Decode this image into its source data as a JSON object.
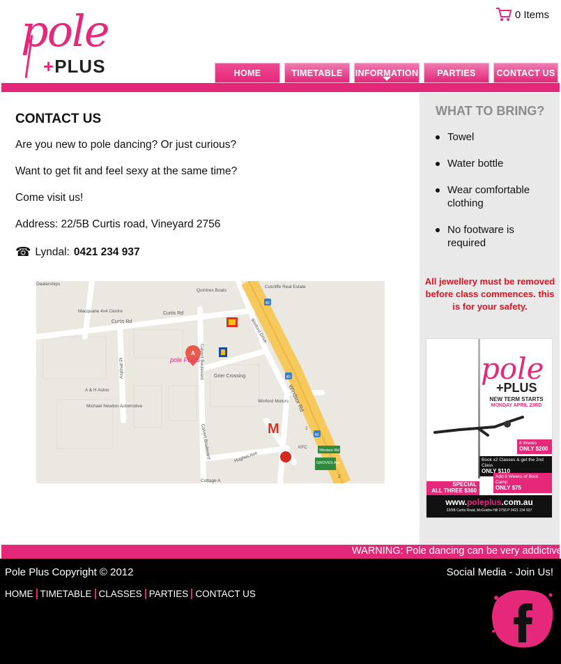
{
  "brand": {
    "logo_top": "pole",
    "logo_bottom": "PLUS",
    "accent": "#e3287a"
  },
  "cart": {
    "icon": "cart-icon",
    "label": "0 Items"
  },
  "nav": [
    {
      "label": "HOME",
      "active": true
    },
    {
      "label": "TIMETABLE",
      "active": false
    },
    {
      "label": "INFORMATION",
      "active": false
    },
    {
      "label": "PARTIES",
      "active": false
    },
    {
      "label": "CONTACT US",
      "active": false
    }
  ],
  "main": {
    "title": "CONTACT US",
    "paragraphs": [
      "Are you new to pole dancing? Or just curious?",
      "Want to get fit and feel sexy at the same time?",
      "Come visit us!",
      "Address: 22/5B Curtis road, Vineyard 2756"
    ],
    "phone_icon": "☎",
    "phone_label": "Lyndal:",
    "phone_number": "0421 234 937"
  },
  "map": {
    "labels": {
      "quintrex": "Quintrex Boats",
      "cutcliffe": "Cutcliffe Real Estate",
      "macquarie": "Macquarie 4x4 Centre",
      "curtis1": "Curtis Rd",
      "curtis2": "Curtis Rd",
      "winford_drive": "Winford Drive",
      "aspinall": "Aspinall Pl",
      "grier": "Grier Crossing",
      "calvert1": "Calvert Boulevard",
      "calvert2": "Calvert Boulevard",
      "ah_autos": "A & H Autos",
      "michael": "Michael Newton Automotive",
      "winford_motors": "Winford Motors",
      "windsor": "Windsor Rd",
      "hughes": "Hughes Ave",
      "kfc": "KFC",
      "windsor_rd_sign": "Windsor Rd",
      "groves": "GROVES Ave",
      "cottage": "Cottage A",
      "route": "40",
      "route2": "40",
      "route3": "40",
      "route_2": "2",
      "route_2b": "2",
      "marker": "A",
      "map_logo": "pole PLUS",
      "dealers": "Dealerships"
    }
  },
  "sidebar": {
    "title": "WHAT TO BRING?",
    "items": [
      "Towel",
      "Water bottle",
      "Wear comfortable clothing",
      "No footware is required"
    ],
    "warning": "All jewellery must be removed before class commences. this is for your safety.",
    "promo": {
      "title": "pole",
      "plus": "PLUS",
      "new_term": "NEW TERM STARTS",
      "date": "MONDAY APRIL 23RD",
      "box1_a": "8 Weeks",
      "box1_b": "ONLY $200",
      "box2_a": "Book x2 Classes & get the 2nd Class",
      "box2_b": "ONLY $110",
      "box3_a": "Add 8 Weeks of Boot Camp",
      "box3_b": "ONLY $75",
      "special_a": "SPECIAL",
      "special_b": "ALL THREE $360",
      "url_a": "www.",
      "url_b": "poleplus",
      "url_c": ".com.au",
      "address": "22/5B Curtis Road, McGraths Hill 2756    P  0421 234 937"
    }
  },
  "ticker": {
    "text": "WARNING: Pole dancing can be very addictive"
  },
  "footer": {
    "copyright": "Pole Plus Copyright © 2012",
    "social_title": "Social Media - Join Us!",
    "links": [
      "HOME",
      "TIMETABLE",
      "CLASSES",
      "PARTIES",
      "CONTACT US"
    ],
    "facebook_icon": "facebook-icon"
  }
}
